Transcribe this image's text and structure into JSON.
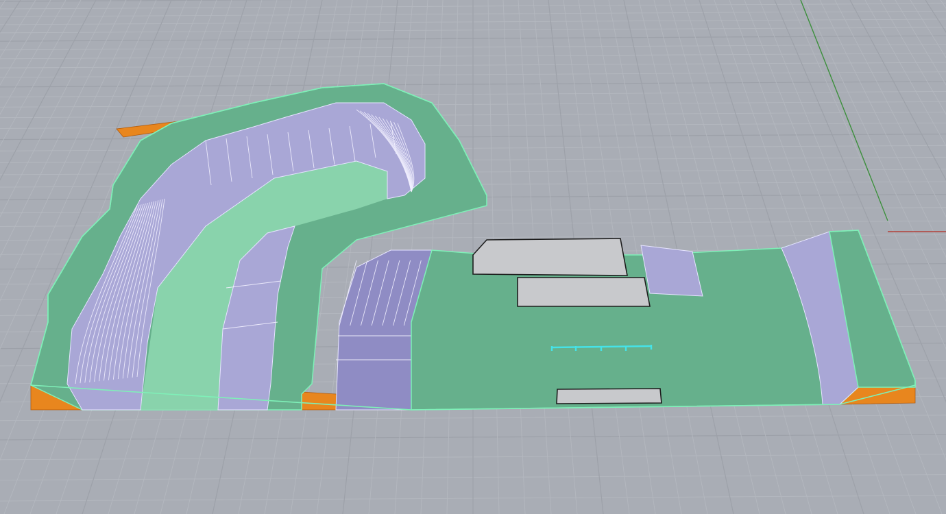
{
  "viewport": {
    "background": "#a9adb5",
    "grid_minor_color": "#b4b8bf",
    "grid_major_color": "#9da1a9",
    "x_axis_color": "#b3403a",
    "y_axis_color": "#3c8f3c"
  },
  "model": {
    "deck_color": "#66b08c",
    "deck_light_color": "#8fd9b2",
    "ramp_color": "#a9a7d6",
    "ramp_shade_color": "#8f8cc4",
    "side_color": "#e8861e",
    "edge_highlight_color": "#7ff0b8",
    "box_color": "#c8c9cc",
    "rail_color": "#45e3e8"
  }
}
